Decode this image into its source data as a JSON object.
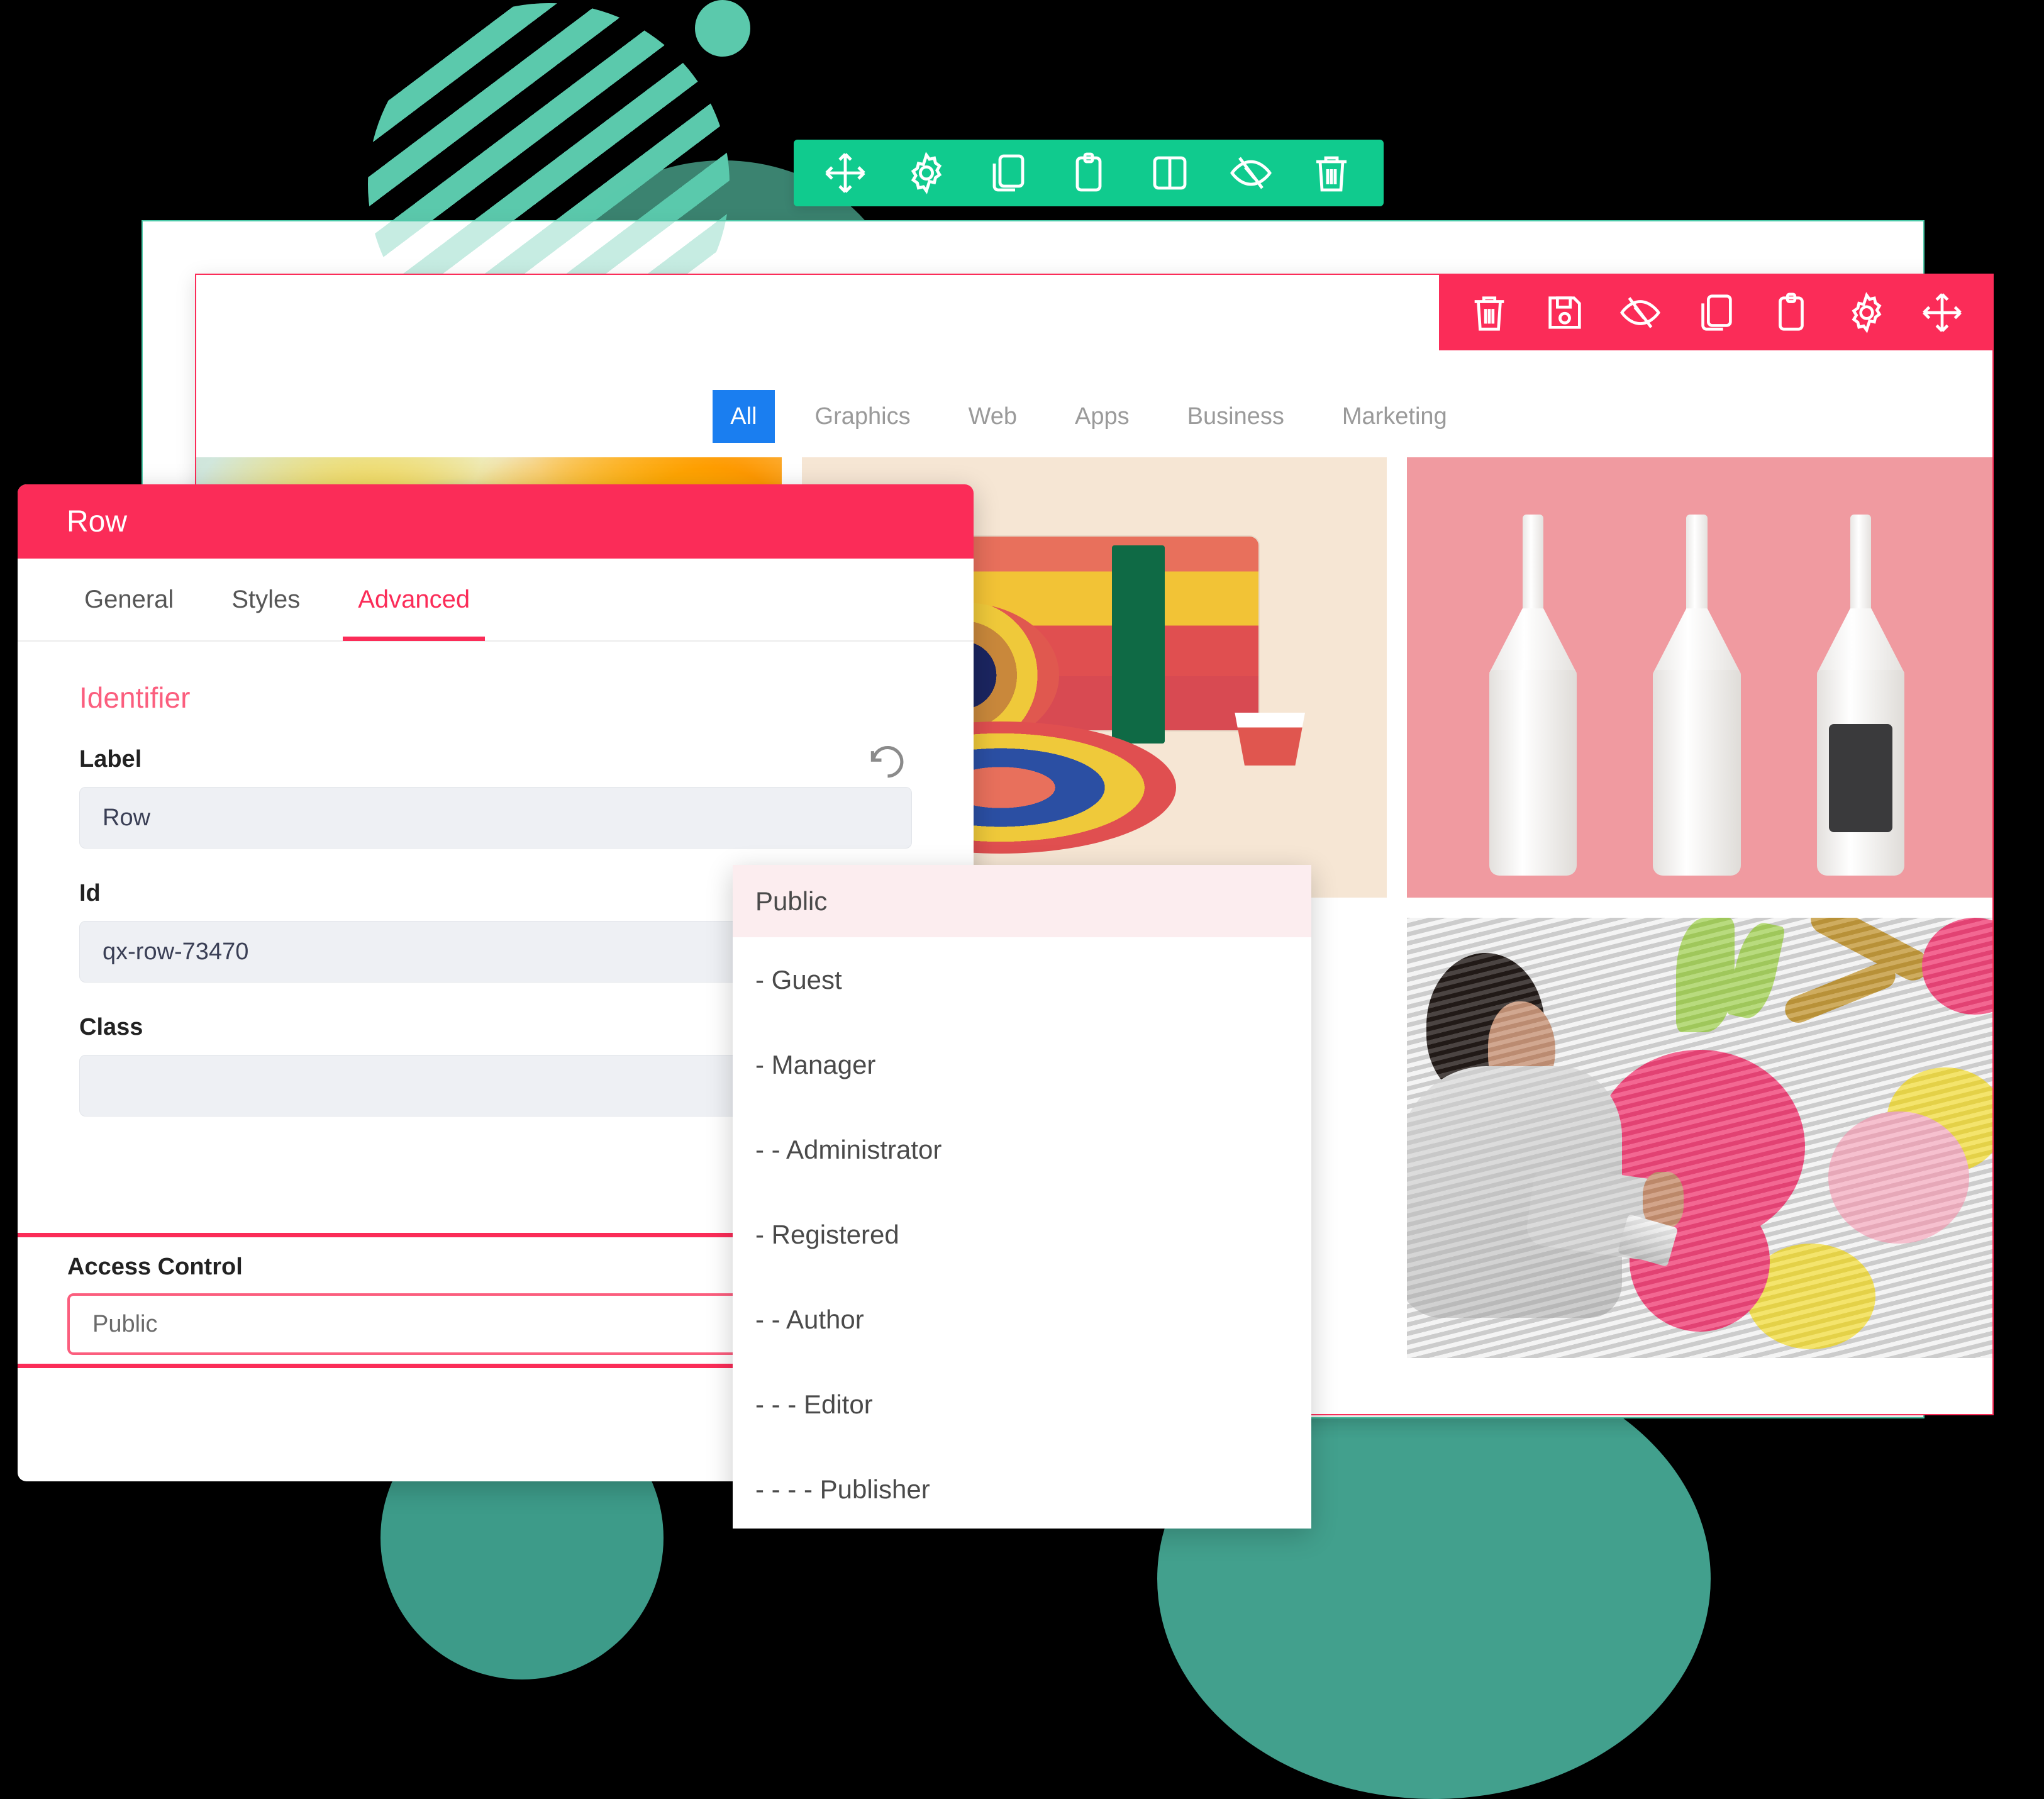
{
  "green_toolbar": {
    "icons": [
      {
        "name": "move-icon",
        "label": "Move"
      },
      {
        "name": "gear-icon",
        "label": "Settings"
      },
      {
        "name": "copy-icon",
        "label": "Duplicate"
      },
      {
        "name": "clipboard-icon",
        "label": "Paste"
      },
      {
        "name": "columns-icon",
        "label": "Columns"
      },
      {
        "name": "eye-slash-icon",
        "label": "Hide"
      },
      {
        "name": "trash-icon",
        "label": "Delete"
      }
    ]
  },
  "red_toolbar": {
    "icons": [
      {
        "name": "trash-icon",
        "label": "Delete"
      },
      {
        "name": "save-icon",
        "label": "Save"
      },
      {
        "name": "eye-slash-icon",
        "label": "Hide"
      },
      {
        "name": "copy-icon",
        "label": "Duplicate"
      },
      {
        "name": "clipboard-icon",
        "label": "Paste"
      },
      {
        "name": "gear-icon",
        "label": "Settings"
      },
      {
        "name": "move-icon",
        "label": "Move"
      }
    ]
  },
  "gallery": {
    "filters": [
      {
        "label": "All",
        "active": true
      },
      {
        "label": "Graphics",
        "active": false
      },
      {
        "label": "Web",
        "active": false
      },
      {
        "label": "Apps",
        "active": false
      },
      {
        "label": "Business",
        "active": false
      },
      {
        "label": "Marketing",
        "active": false
      }
    ],
    "items": [
      {
        "name": "abstract-paint-artwork"
      },
      {
        "name": "melting-camera-artwork"
      },
      {
        "name": "ceramic-bottle-mockup"
      },
      {
        "name": "street-mural-artist-photo"
      }
    ]
  },
  "row_dialog": {
    "title": "Row",
    "tabs": [
      {
        "label": "General",
        "active": false
      },
      {
        "label": "Styles",
        "active": false
      },
      {
        "label": "Advanced",
        "active": true
      }
    ],
    "section_title": "Identifier",
    "fields": {
      "label": {
        "label": "Label",
        "value": "Row"
      },
      "id": {
        "label": "Id",
        "value": "qx-row-73470"
      },
      "class": {
        "label": "Class",
        "value": ""
      }
    },
    "access_control": {
      "label": "Access Control",
      "value": "Public"
    }
  },
  "access_dropdown": {
    "selected": "Public",
    "options": [
      "- Guest",
      "- Manager",
      "- - Administrator",
      "- Registered",
      "- - Author",
      "- - - Editor",
      "- - - - Publisher"
    ]
  },
  "colors": {
    "green_accent": "#10CB8E",
    "red_accent": "#FB2C58",
    "blue_accent": "#1A7EF0",
    "teal_deco": "#5BC9AC",
    "pink_strip": "#FF5BA7"
  }
}
